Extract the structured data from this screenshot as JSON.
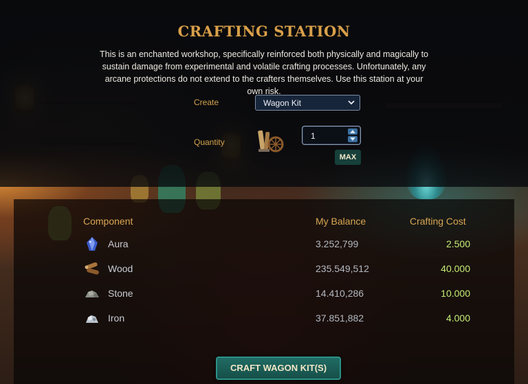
{
  "station": {
    "title": "CRAFTING STATION",
    "description": "This is an enchanted workshop, specifically reinforced both physically and magically to sustain damage from experimental and volatile crafting processes. Unfortunately, any arcane protections do not extend to the crafters themselves. Use this station at your own risk."
  },
  "form": {
    "create_label": "Create",
    "create_value": "Wagon Kit",
    "quantity_label": "Quantity",
    "quantity_value": "1",
    "max_label": "MAX"
  },
  "table": {
    "headers": [
      "Component",
      "My Balance",
      "Crafting Cost"
    ],
    "rows": [
      {
        "name": "Aura",
        "balance": "3.252,799",
        "cost": "2.500",
        "icon": "aura-icon"
      },
      {
        "name": "Wood",
        "balance": "235.549,512",
        "cost": "40.000",
        "icon": "wood-icon"
      },
      {
        "name": "Stone",
        "balance": "14.410,286",
        "cost": "10.000",
        "icon": "stone-icon"
      },
      {
        "name": "Iron",
        "balance": "37.851,882",
        "cost": "4.000",
        "icon": "iron-icon"
      }
    ]
  },
  "craft_button_label": "CRAFT WAGON KIT(S)",
  "colors": {
    "title": "#d9a04a",
    "cost": "#c5ec76",
    "button": "#1f6b63"
  }
}
